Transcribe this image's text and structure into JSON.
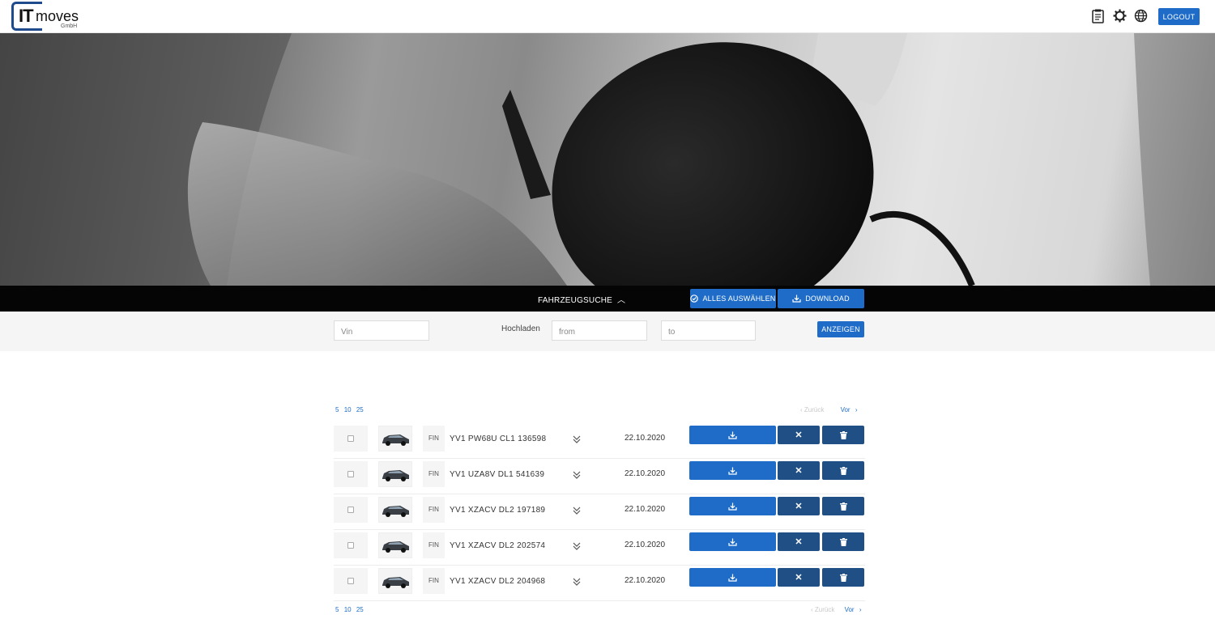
{
  "header": {
    "logo_it": "IT",
    "logo_moves": "moves",
    "logo_sub": "GmbH",
    "icons": [
      "clipboard-icon",
      "settings-icon",
      "globe-icon"
    ],
    "logout_label": "LOGOUT"
  },
  "hero": {
    "image": "ev-charging-plug-photo"
  },
  "searchbar": {
    "toggle_label": "FAHRZEUGSUCHE",
    "toggle_icon": "chevron-up-icon",
    "select_all_label": "ALLES AUSWÄHLEN",
    "download_label": "DOWNLOAD"
  },
  "filter": {
    "vin_placeholder": "Vin",
    "upload_label": "Hochladen",
    "from_placeholder": "from",
    "to_placeholder": "to",
    "show_label": "ANZEIGEN"
  },
  "pagination": {
    "sizes": [
      "5",
      "10",
      "25"
    ],
    "prev_label": "Zurück",
    "next_label": "Vor"
  },
  "vehicles": [
    {
      "fin_label": "FIN",
      "vin": "YV1 PW68U CL1 136598",
      "date": "22.10.2020"
    },
    {
      "fin_label": "FIN",
      "vin": "YV1 UZA8V DL1 541639",
      "date": "22.10.2020"
    },
    {
      "fin_label": "FIN",
      "vin": "YV1 XZACV DL2 197189",
      "date": "22.10.2020"
    },
    {
      "fin_label": "FIN",
      "vin": "YV1 XZACV DL2 202574",
      "date": "22.10.2020"
    },
    {
      "fin_label": "FIN",
      "vin": "YV1 XZACV DL2 204968",
      "date": "22.10.2020"
    }
  ],
  "colors": {
    "primary": "#1e6cc8",
    "secondary": "#1f4f85",
    "bar": "#050505"
  }
}
